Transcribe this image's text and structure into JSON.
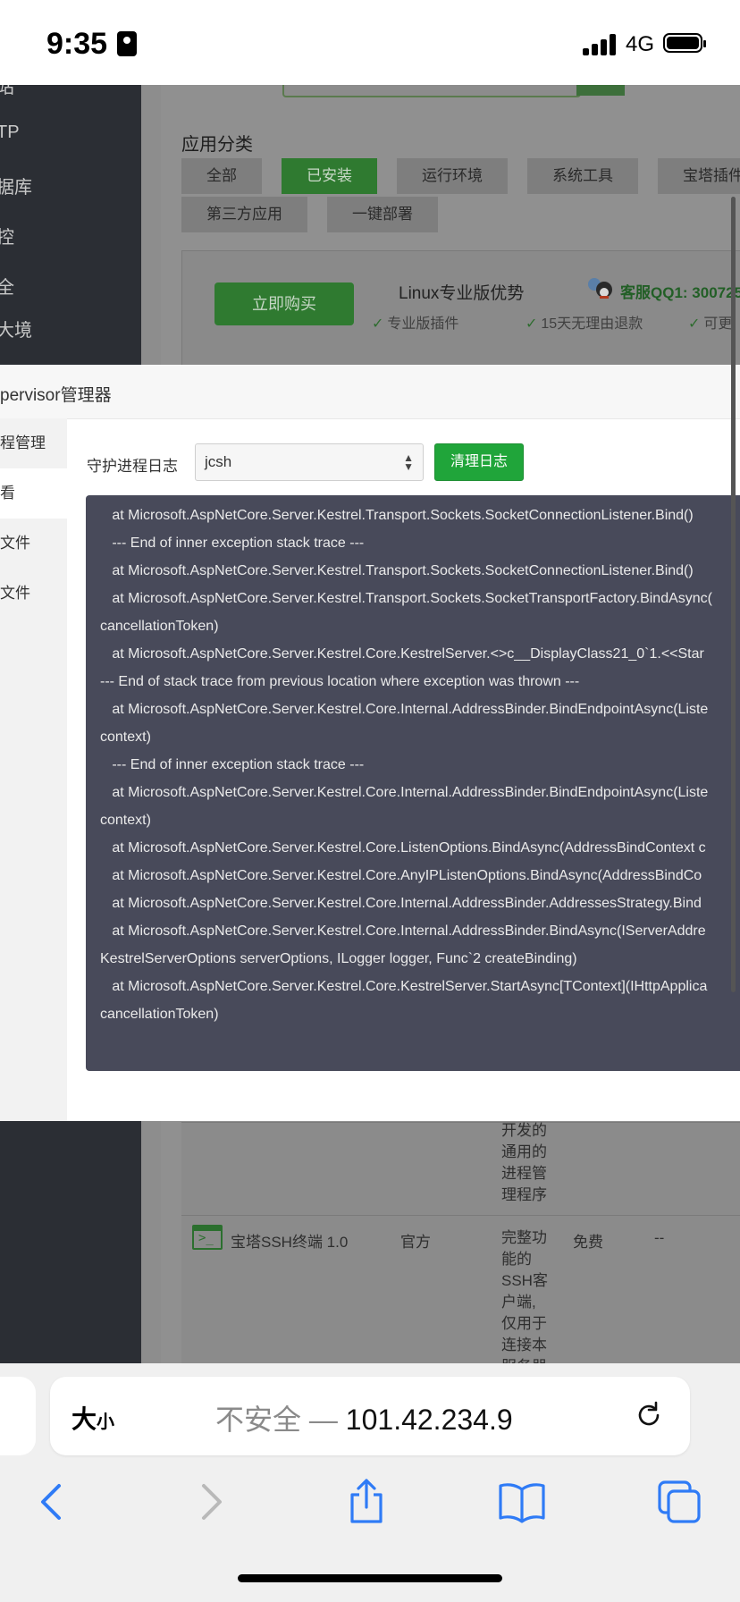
{
  "status_bar": {
    "time": "9:35",
    "network": "4G"
  },
  "background": {
    "sidebar_items": [
      "站",
      "TP",
      "据库",
      "控",
      "全",
      "大境"
    ],
    "category_label": "应用分类",
    "categories": [
      "全部",
      "已安装",
      "运行环境",
      "系统工具",
      "宝塔插件",
      "第三方应用",
      "一键部署"
    ],
    "active_category": "已安装",
    "buy_button": "立即购买",
    "pro_title": "Linux专业版优势",
    "qq_text": "客服QQ1: 300725",
    "features": [
      "专业版插件",
      "15天无理由退款",
      "可更"
    ],
    "prev_row_desc": [
      "开发的",
      "通用的",
      "进程管",
      "理程序"
    ],
    "ssh_row": {
      "name": "宝塔SSH终端 1.0",
      "developer": "官方",
      "desc": [
        "完整功",
        "能的",
        "SSH客",
        "户端,",
        "仅用于",
        "连接本",
        "服务器"
      ],
      "price": "免费",
      "expire": "--"
    }
  },
  "modal": {
    "title": "pervisor管理器",
    "tabs": [
      "程管理",
      "看",
      "文件",
      "文件"
    ],
    "active_tab_index": 1,
    "log_label": "守护进程日志",
    "select_value": "jcsh",
    "clear_button": "清理日志",
    "log_lines": [
      "   at Microsoft.AspNetCore.Server.Kestrel.Transport.Sockets.SocketConnectionListener.Bind()",
      "   --- End of inner exception stack trace ---",
      "   at Microsoft.AspNetCore.Server.Kestrel.Transport.Sockets.SocketConnectionListener.Bind()",
      "   at Microsoft.AspNetCore.Server.Kestrel.Transport.Sockets.SocketTransportFactory.BindAsync(",
      "cancellationToken)",
      "   at Microsoft.AspNetCore.Server.Kestrel.Core.KestrelServer.<>c__DisplayClass21_0`1.<<Star",
      "--- End of stack trace from previous location where exception was thrown ---",
      "   at Microsoft.AspNetCore.Server.Kestrel.Core.Internal.AddressBinder.BindEndpointAsync(Liste",
      "context)",
      "   --- End of inner exception stack trace ---",
      "   at Microsoft.AspNetCore.Server.Kestrel.Core.Internal.AddressBinder.BindEndpointAsync(Liste",
      "context)",
      "   at Microsoft.AspNetCore.Server.Kestrel.Core.ListenOptions.BindAsync(AddressBindContext c",
      "   at Microsoft.AspNetCore.Server.Kestrel.Core.AnyIPListenOptions.BindAsync(AddressBindCo",
      "   at Microsoft.AspNetCore.Server.Kestrel.Core.Internal.AddressBinder.AddressesStrategy.Bind",
      "   at Microsoft.AspNetCore.Server.Kestrel.Core.Internal.AddressBinder.BindAsync(IServerAddre",
      "KestrelServerOptions serverOptions, ILogger logger, Func`2 createBinding)",
      "   at Microsoft.AspNetCore.Server.Kestrel.Core.KestrelServer.StartAsync[TContext](IHttpApplica",
      "cancellationToken)"
    ]
  },
  "browser": {
    "text_size_label": "大",
    "text_size_small": "小",
    "insecure_label": "不安全 — ",
    "host": "101.42.234.9"
  },
  "colors": {
    "accent_green": "#20a53a",
    "log_bg": "#484a5a",
    "ios_blue": "#2f7bf6"
  }
}
